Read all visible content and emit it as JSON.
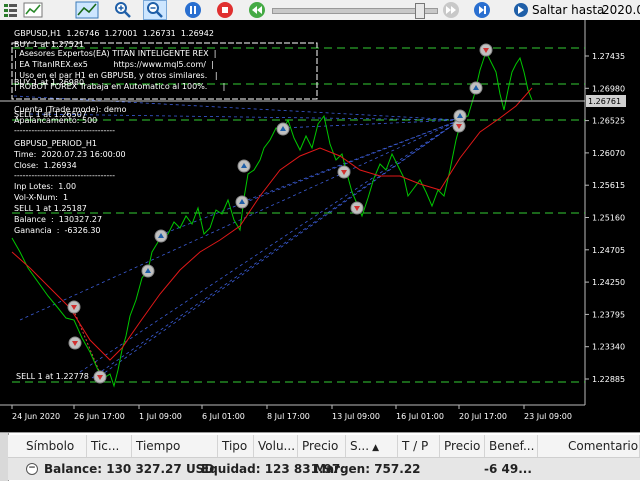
{
  "toolbar": {
    "buttons": [
      {
        "name": "objects-list-icon"
      },
      {
        "name": "line-chart-icon"
      },
      {
        "name": "zoom-in-icon"
      },
      {
        "name": "zoom-out-icon"
      },
      {
        "name": "pause-icon"
      },
      {
        "name": "stop-icon"
      },
      {
        "name": "rewind-icon"
      },
      {
        "name": "fast-forward-icon"
      },
      {
        "name": "skip-forward-icon"
      }
    ],
    "skip_label": "Saltar hasta",
    "date": "2020.0"
  },
  "chart": {
    "symbol_line": "GBPUSD,H1  1.26746  1.27001  1.26731  1.26942",
    "ea_box": [
      "| Asesores Expertos(EA) TITAN INTELIGENTE REX  |",
      "| EA TitanIREX.ex5          https://www.mql5.com/  |",
      "| Uso en el par H1 en GBPUSB, y otros similares.   |",
      "| ROBOT FOREX Trabaja en Automatico al 100%.      |"
    ],
    "account_lines": [
      "Cuenta (Trade mode): demo",
      "Apalancamento: 500",
      "-----------------------------------"
    ],
    "period_lines": [
      "GBPUSD_PERIOD_H1",
      "Time:  2020.07.23 16:00:00",
      "Close:  1.26934",
      "-----------------------------------"
    ],
    "lot_lines": [
      "Inp Lotes:  1.00",
      "Vol-X-Num:  1"
    ],
    "balance_lines": [
      "Balance  :  130327.27",
      "Ganancia  :  -6326.30"
    ],
    "trade_labels": [
      "BUY 1 at 1.27521",
      "BUY 1 at 1.26980",
      "SELL 1 at 1.26507",
      "SELL 1 at 1.25187",
      "SELL 1 at 1.22778"
    ],
    "price_ticks": [
      "1.27435",
      "1.26980",
      "1.26525",
      "1.26070",
      "1.25615",
      "1.25160",
      "1.24705",
      "1.24250",
      "1.23795",
      "1.23340",
      "1.22885"
    ],
    "current_price": "1.26761",
    "time_ticks": [
      "24 Jun 2020",
      "26 Jun 17:00",
      "1 Jul 09:00",
      "6 Jul 01:00",
      "8 Jul 17:00",
      "13 Jul 09:00",
      "16 Jul 01:00",
      "20 Jul 17:00",
      "23 Jul 09:00"
    ],
    "colors": {
      "candles": "#00c800",
      "ma": "#e01818",
      "grid_dashed": "#33cc33",
      "trade_lines": "#3b5cd6",
      "price_marker_bg": "#d0d0d0"
    }
  },
  "panel": {
    "columns": [
      "Símbolo",
      "Tic...",
      "Tiempo",
      "Tipo",
      "Volu...",
      "Precio",
      "S...",
      "T / P",
      "Precio",
      "Benef...",
      "Comentario"
    ],
    "balance": "Balance: 130 327.27 USD",
    "equity": "Equidad: 123 831.97",
    "margin": "Margen: 757.22",
    "profit": "-6 49..."
  }
}
